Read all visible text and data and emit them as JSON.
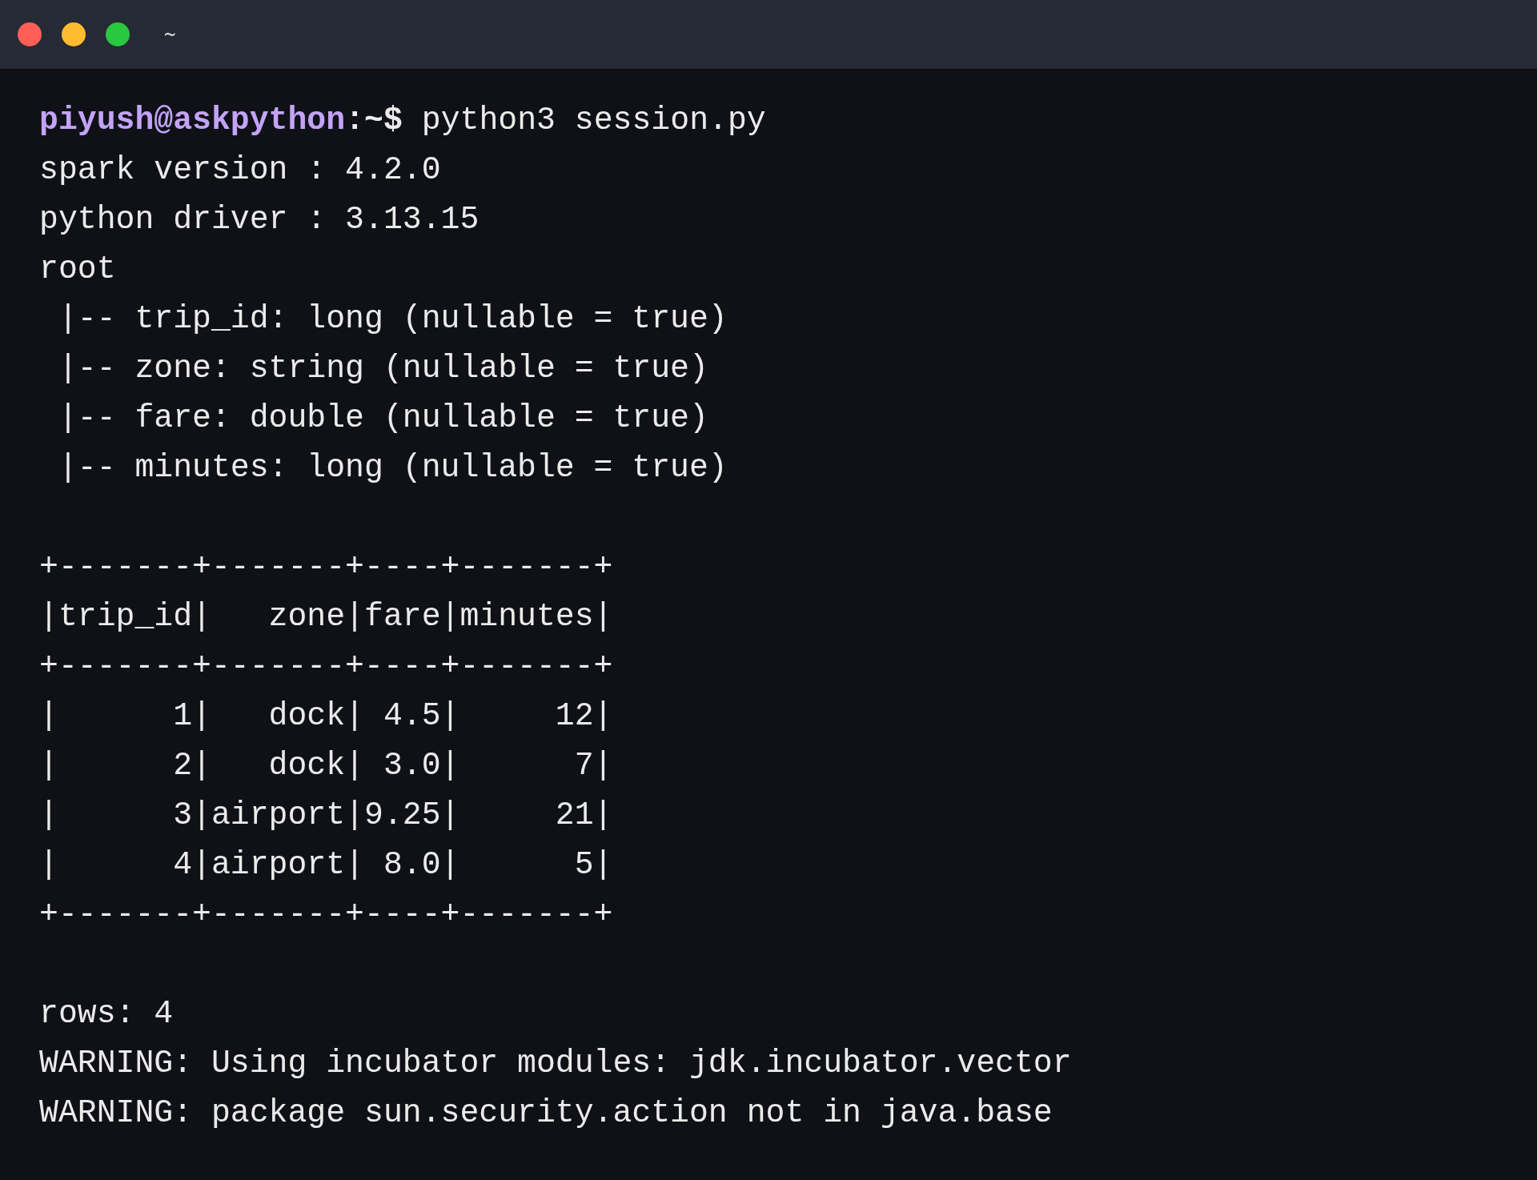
{
  "window": {
    "title": "~",
    "controls": [
      {
        "color": "#ff5f57"
      },
      {
        "color": "#febc2e"
      },
      {
        "color": "#28c840"
      }
    ]
  },
  "terminal": {
    "lines": [
      {
        "kind": "prompt",
        "user": "piyush@askpython",
        "path": ":~$",
        "command": "python3 session.py"
      },
      {
        "kind": "output",
        "text": "spark version : 4.2.0"
      },
      {
        "kind": "output",
        "text": "python driver : 3.13.15"
      },
      {
        "kind": "output",
        "text": "root"
      },
      {
        "kind": "output",
        "text": " |-- trip_id: long (nullable = true)"
      },
      {
        "kind": "output",
        "text": " |-- zone: string (nullable = true)"
      },
      {
        "kind": "output",
        "text": " |-- fare: double (nullable = true)"
      },
      {
        "kind": "output",
        "text": " |-- minutes: long (nullable = true)"
      },
      {
        "kind": "blank"
      },
      {
        "kind": "output",
        "text": "+-------+-------+----+-------+"
      },
      {
        "kind": "output",
        "text": "|trip_id|   zone|fare|minutes|"
      },
      {
        "kind": "output",
        "text": "+-------+-------+----+-------+"
      },
      {
        "kind": "output",
        "text": "|      1|   dock| 4.5|     12|"
      },
      {
        "kind": "output",
        "text": "|      2|   dock| 3.0|      7|"
      },
      {
        "kind": "output",
        "text": "|      3|airport|9.25|     21|"
      },
      {
        "kind": "output",
        "text": "|      4|airport| 8.0|      5|"
      },
      {
        "kind": "output",
        "text": "+-------+-------+----+-------+"
      },
      {
        "kind": "blank"
      },
      {
        "kind": "output",
        "text": "rows: 4"
      },
      {
        "kind": "output",
        "text": "WARNING: Using incubator modules: jdk.incubator.vector"
      },
      {
        "kind": "output",
        "text": "WARNING: package sun.security.action not in java.base"
      }
    ]
  }
}
